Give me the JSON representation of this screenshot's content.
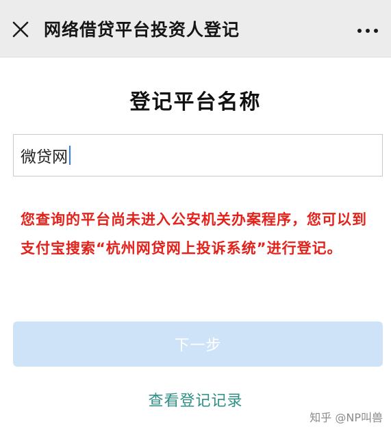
{
  "nav": {
    "title": "网络借贷平台投资人登记",
    "close_icon": "close-icon",
    "more_icon": "more-dots-icon"
  },
  "form": {
    "title": "登记平台名称",
    "platform_input_value": "微贷网"
  },
  "error": {
    "message": "您查询的平台尚未进入公安机关办案程序，您可以到支付宝搜索“杭州网贷网上投诉系统”进行登记。",
    "color": "#e3211a"
  },
  "actions": {
    "next_label": "下一步",
    "view_records_label": "查看登记记录"
  },
  "watermark": {
    "text": "知乎 @NP叫兽"
  }
}
